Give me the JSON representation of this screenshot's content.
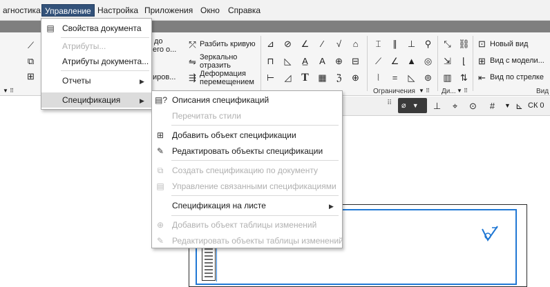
{
  "menubar": {
    "items": [
      "агностика",
      "Управление",
      "Настройка",
      "Приложения",
      "Окно",
      "Справка"
    ]
  },
  "ribbon": {
    "btn1_top": "до",
    "btn1_bottom": "его о...",
    "btn2": "иров...",
    "split_curve": "Разбить кривую",
    "mirror_line1": "Зеркально",
    "mirror_line2": "отразить",
    "deform_line1": "Деформация",
    "deform_line2": "перемещением",
    "new_view": "Новый вид",
    "view_from_model": "Вид с модели...",
    "view_by_arrow": "Вид по стрелке",
    "group_constraints": "Ограничения",
    "group_di": "Ди...",
    "group_vid": "Вид"
  },
  "lowerbar": {
    "cs_label": "СК 0"
  },
  "menu_upravlenie": {
    "items": [
      {
        "label": "Свойства документа",
        "icon": "doc-properties-icon",
        "disabled": false
      },
      {
        "label": "Атрибуты...",
        "disabled": true
      },
      {
        "label": "Атрибуты документа...",
        "disabled": false
      },
      {
        "label": "Отчеты",
        "disabled": false,
        "submenu": true
      },
      {
        "label": "Спецификация",
        "disabled": false,
        "submenu": true,
        "highlighted": true
      }
    ]
  },
  "menu_spec": {
    "items": [
      {
        "label": "Описания спецификаций",
        "icon": "spec-description-icon",
        "disabled": false
      },
      {
        "label": "Перечитать стили",
        "disabled": true
      },
      {
        "label": "Добавить объект спецификации",
        "icon": "add-spec-object-icon",
        "disabled": false
      },
      {
        "label": "Редактировать объекты спецификации",
        "icon": "edit-spec-objects-icon",
        "disabled": false
      },
      {
        "label": "Создать спецификацию по документу",
        "icon": "create-spec-icon",
        "disabled": true
      },
      {
        "label": "Управление связанными спецификациями",
        "icon": "linked-specs-icon",
        "disabled": true
      },
      {
        "label": "Спецификация на листе",
        "disabled": false,
        "submenu": true
      },
      {
        "label": "Добавить объект таблицы изменений",
        "icon": "add-change-table-icon",
        "disabled": true
      },
      {
        "label": "Редактировать объекты таблицы изменений",
        "icon": "edit-change-table-icon",
        "disabled": true
      }
    ]
  },
  "colors": {
    "menu_active": "#33527a",
    "drawing_frame": "#1f77d4",
    "disabled_text": "#b0b0b0"
  }
}
